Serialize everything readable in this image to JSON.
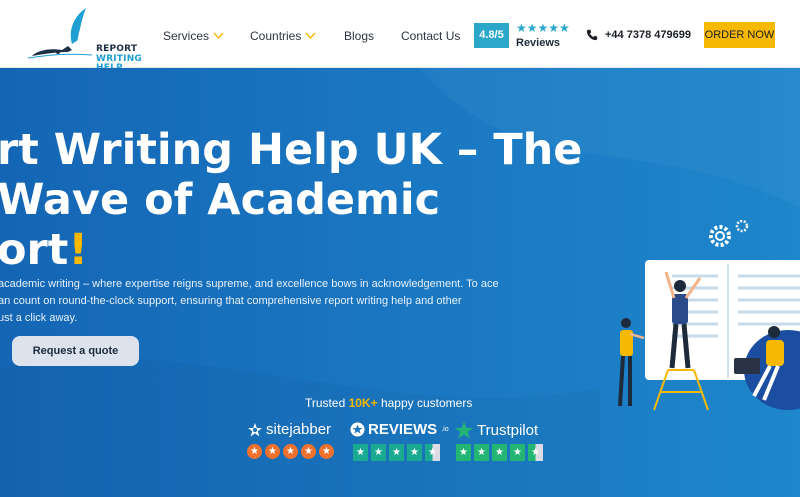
{
  "header": {
    "logo": {
      "line1": "REPORT",
      "line2": "WRITING HELP"
    },
    "nav": [
      {
        "label": "Services",
        "has_dropdown": true
      },
      {
        "label": "Countries",
        "has_dropdown": true
      },
      {
        "label": "Blogs",
        "has_dropdown": false
      },
      {
        "label": "Contact Us",
        "has_dropdown": false
      }
    ],
    "rating": {
      "score": "4.8/5",
      "stars": "★★★★★",
      "label": "Reviews"
    },
    "phone": "+44 7378 479699",
    "order_button": "ORDER NOW"
  },
  "hero": {
    "title_lines": [
      "rt Writing Help UK – The",
      "Wave of Academic",
      "ort"
    ],
    "title_exclaim": "!",
    "description_lines": [
      "academic writing – where expertise reigns supreme, and excellence bows in acknowledgement. To ace",
      "an count on round-the-clock support, ensuring that comprehensive report writing help and other",
      "ust a click away."
    ],
    "cta_button": "Request a quote",
    "trusted": {
      "prefix": "Trusted ",
      "highlight": "10K+",
      "suffix": " happy customers"
    },
    "review_sites": {
      "sitejabber": "sitejabber",
      "reviews_io": "REVIEWS",
      "reviews_io_suffix": ".io",
      "trustpilot": "Trustpilot"
    }
  },
  "colors": {
    "accent_yellow": "#f6b800",
    "rating_teal": "#2aa7c9",
    "hero_blue": "#1a75c0",
    "sitejabber_orange": "#f0712e",
    "reviews_green": "#1aaa92",
    "trustpilot_green": "#22b574"
  }
}
